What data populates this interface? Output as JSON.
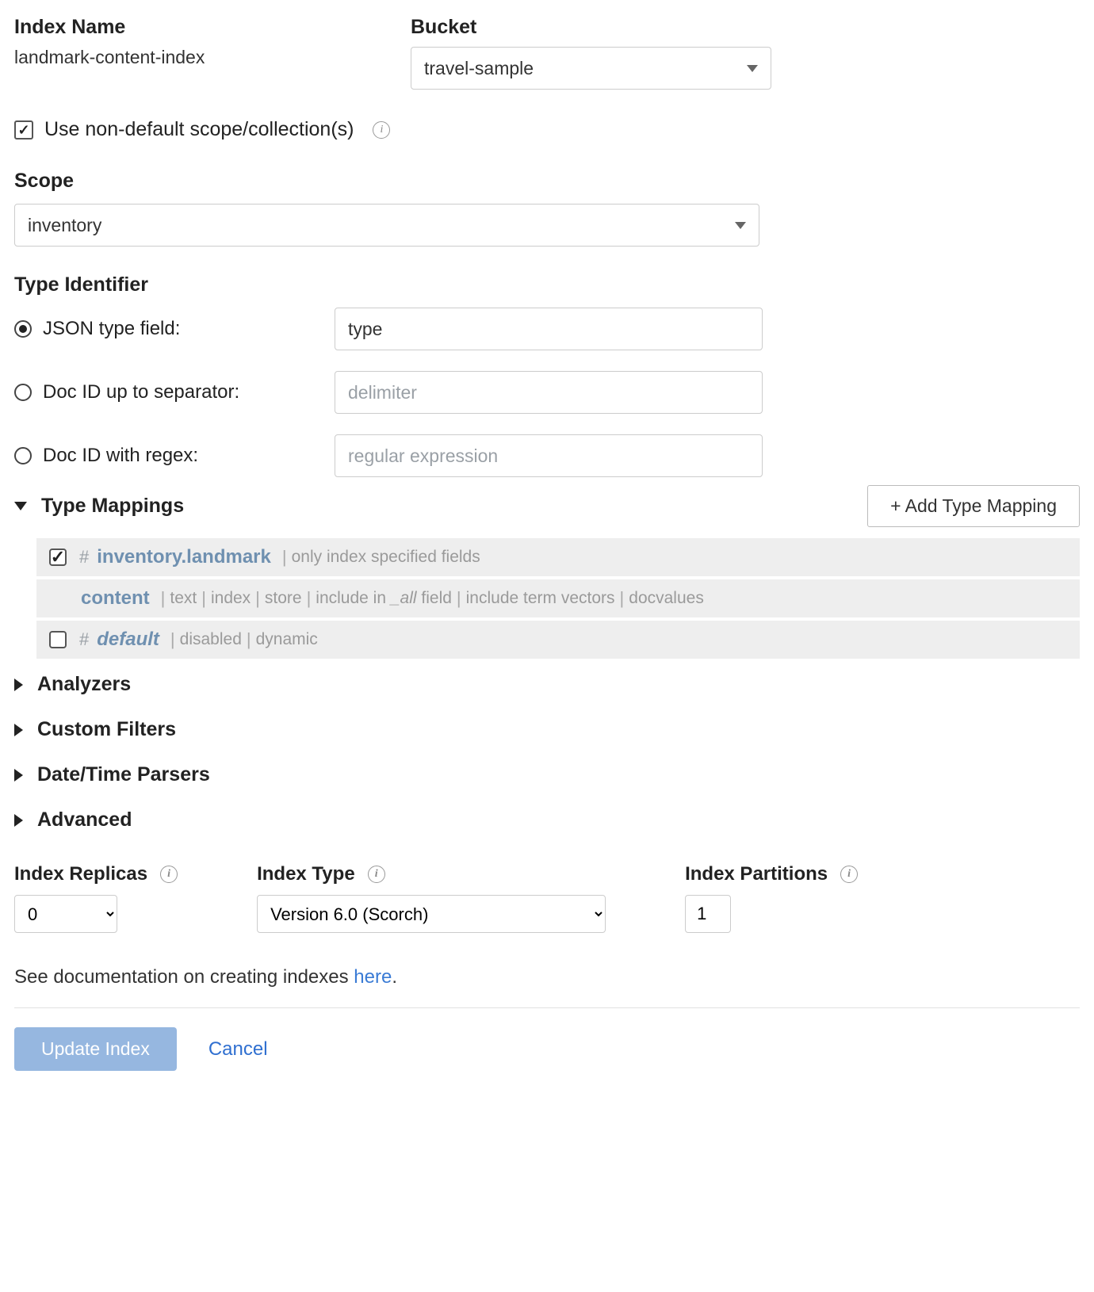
{
  "header": {
    "indexName": {
      "label": "Index Name",
      "value": "landmark-content-index"
    },
    "bucket": {
      "label": "Bucket",
      "selected": "travel-sample"
    }
  },
  "useNonDefault": {
    "checked": true,
    "label": "Use non-default scope/collection(s)"
  },
  "scope": {
    "label": "Scope",
    "selected": "inventory"
  },
  "typeIdentifier": {
    "label": "Type Identifier",
    "options": {
      "jsonTypeField": {
        "label": "JSON type field:",
        "selected": true,
        "value": "type"
      },
      "docIdSep": {
        "label": "Doc ID up to separator:",
        "selected": false,
        "placeholder": "delimiter"
      },
      "docIdRegex": {
        "label": "Doc ID with regex:",
        "selected": false,
        "placeholder": "regular expression"
      }
    }
  },
  "typeMappings": {
    "label": "Type Mappings",
    "addButton": "+ Add Type Mapping",
    "rows": [
      {
        "checked": true,
        "name": "inventory.landmark",
        "flags": [
          "only index specified fields"
        ],
        "children": [
          {
            "name": "content",
            "flags": [
              "text",
              "index",
              "store",
              "include in _all field",
              "include term vectors",
              "docvalues"
            ]
          }
        ]
      },
      {
        "checked": false,
        "name": "default",
        "italic": true,
        "flags": [
          "disabled",
          "dynamic"
        ]
      }
    ]
  },
  "accordions": {
    "analyzers": "Analyzers",
    "filters": "Custom Filters",
    "parsers": "Date/Time Parsers",
    "advanced": "Advanced"
  },
  "bottom": {
    "replicas": {
      "label": "Index Replicas",
      "value": "0"
    },
    "indexType": {
      "label": "Index Type",
      "value": "Version 6.0 (Scorch)"
    },
    "partitions": {
      "label": "Index Partitions",
      "value": "1"
    }
  },
  "docLine": {
    "text": "See documentation on creating indexes ",
    "link": "here",
    "suffix": "."
  },
  "actions": {
    "update": "Update Index",
    "cancel": "Cancel"
  }
}
